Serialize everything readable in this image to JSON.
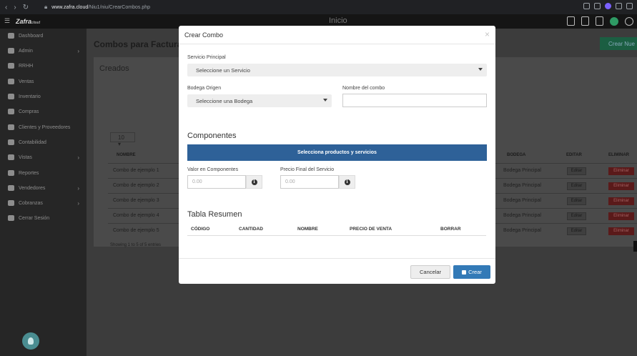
{
  "browser": {
    "url_host": "www.zafra.cloud",
    "url_path": "/Niu1/niu/CrearCombos.php"
  },
  "topbar": {
    "logo": "Zafra",
    "logo_suffix": "cloud",
    "heading": "Inicio"
  },
  "sidebar": {
    "items": [
      {
        "label": "Dashboard",
        "icon": "dashboard-icon",
        "has_submenu": false
      },
      {
        "label": "Admin",
        "icon": "wrench-icon",
        "has_submenu": true
      },
      {
        "label": "RRHH",
        "icon": "users-icon",
        "has_submenu": false
      },
      {
        "label": "Ventas",
        "icon": "money-icon",
        "has_submenu": false
      },
      {
        "label": "Inventario",
        "icon": "inventory-icon",
        "has_submenu": false
      },
      {
        "label": "Compras",
        "icon": "cart-icon",
        "has_submenu": false
      },
      {
        "label": "Clientes y Proveedores",
        "icon": "contacts-icon",
        "has_submenu": false
      },
      {
        "label": "Contabilidad",
        "icon": "book-icon",
        "has_submenu": false
      },
      {
        "label": "Vistas",
        "icon": "edit-icon",
        "has_submenu": true
      },
      {
        "label": "Reportes",
        "icon": "report-icon",
        "has_submenu": false
      },
      {
        "label": "Vendedores",
        "icon": "user-icon",
        "has_submenu": true
      },
      {
        "label": "Cobranzas",
        "icon": "edit-icon",
        "has_submenu": true
      },
      {
        "label": "Cerrar Sesión",
        "icon": "power-icon",
        "has_submenu": false
      }
    ]
  },
  "page": {
    "title": "Combos para Facturaci",
    "new_button": "Crear Nue",
    "panel_title": "Creados",
    "page_length": "10",
    "columns": {
      "nombre": "NOMBRE",
      "bodega": "BODEGA",
      "editar": "EDITAR",
      "eliminar": "ELIMINAR"
    },
    "rows": [
      {
        "nombre": "Combo de ejemplo 1",
        "bodega": "Bodega Principal",
        "editar": "Editar",
        "eliminar": "Eliminar"
      },
      {
        "nombre": "Combo de ejemplo 2",
        "bodega": "Bodega Principal",
        "editar": "Editar",
        "eliminar": "Eliminar"
      },
      {
        "nombre": "Combo de ejemplo 3",
        "bodega": "Bodega Principal",
        "editar": "Editar",
        "eliminar": "Eliminar"
      },
      {
        "nombre": "Combo de ejemplo 4",
        "bodega": "Bodega Principal",
        "editar": "Editar",
        "eliminar": "Eliminar"
      },
      {
        "nombre": "Combo de ejemplo 5",
        "bodega": "Bodega Principal",
        "editar": "Editar",
        "eliminar": "Eliminar"
      }
    ],
    "showing": "Showing 1 to 5 of 5 entries",
    "pager_current": "1"
  },
  "modal": {
    "title": "Crear Combo",
    "close": "×",
    "servicio_label": "Servicio Principal",
    "servicio_value": "Seleccione un Servicio",
    "bodega_label": "Bodega Origen",
    "bodega_value": "Seleccione una Bodega",
    "nombre_label": "Nombre del combo",
    "nombre_value": "",
    "componentes_title": "Componentes",
    "pick_button": "Selecciona productos y servicios",
    "valor_label": "Valor en Componentes",
    "valor_placeholder": "0.00",
    "precio_label": "Precio Final del Servicio",
    "precio_placeholder": "0.00",
    "resumen_title": "Tabla Resumen",
    "resumen_columns": [
      "CÓDIGO",
      "CANTIDAD",
      "NOMBRE",
      "PRECIO DE VENTA",
      "BORRAR"
    ],
    "cancel_button": "Cancelar",
    "create_button": "Crear"
  },
  "colors": {
    "primary": "#337ab7",
    "pick_button": "#2e6198",
    "danger": "#5a1a1a",
    "success": "#1b5e42",
    "sidebar_bg": "#262626"
  }
}
